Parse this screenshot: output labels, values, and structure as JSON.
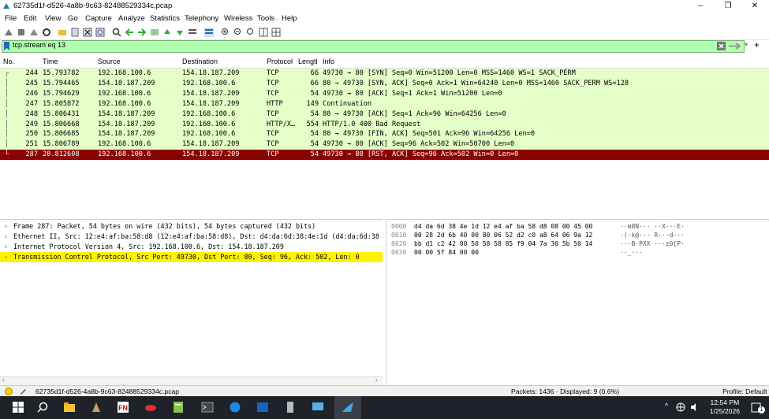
{
  "window": {
    "title": "62735d1f-d526-4a8b-9c63-82488529334c.pcap",
    "minimize": "–",
    "maximize": "❐",
    "close": "✕"
  },
  "menu": [
    "File",
    "Edit",
    "View",
    "Go",
    "Capture",
    "Analyze",
    "Statistics",
    "Telephony",
    "Wireless",
    "Tools",
    "Help"
  ],
  "filter": {
    "value": "tcp.stream eq 13",
    "plus": "+"
  },
  "columns": [
    "No.",
    "Time",
    "Source",
    "Destination",
    "Protocol",
    "Lengtl",
    "Info"
  ],
  "packets": [
    {
      "no": "244",
      "time": "15.793782",
      "src": "192.168.100.6",
      "dst": "154.18.187.209",
      "proto": "TCP",
      "len": "66",
      "info": "49730 → 80 [SYN] Seq=0 Win=51200 Len=0 MSS=1460 WS=1 SACK_PERM"
    },
    {
      "no": "245",
      "time": "15.794465",
      "src": "154.18.187.209",
      "dst": "192.168.100.6",
      "proto": "TCP",
      "len": "66",
      "info": "80 → 49730 [SYN, ACK] Seq=0 Ack=1 Win=64240 Len=0 MSS=1460 SACK_PERM WS=128"
    },
    {
      "no": "246",
      "time": "15.794629",
      "src": "192.168.100.6",
      "dst": "154.18.187.209",
      "proto": "TCP",
      "len": "54",
      "info": "49730 → 80 [ACK] Seq=1 Ack=1 Win=51200 Len=0"
    },
    {
      "no": "247",
      "time": "15.805872",
      "src": "192.168.100.6",
      "dst": "154.18.187.209",
      "proto": "HTTP",
      "len": "149",
      "info": "Continuation"
    },
    {
      "no": "248",
      "time": "15.806431",
      "src": "154.18.187.209",
      "dst": "192.168.100.6",
      "proto": "TCP",
      "len": "54",
      "info": "80 → 49730 [ACK] Seq=1 Ack=96 Win=64256 Len=0"
    },
    {
      "no": "249",
      "time": "15.806668",
      "src": "154.18.187.209",
      "dst": "192.168.100.6",
      "proto": "HTTP/X…",
      "len": "554",
      "info": "HTTP/1.0 400 Bad Request"
    },
    {
      "no": "250",
      "time": "15.806685",
      "src": "154.18.187.209",
      "dst": "192.168.100.6",
      "proto": "TCP",
      "len": "54",
      "info": "80 → 49730 [FIN, ACK] Seq=501 Ack=96 Win=64256 Len=0"
    },
    {
      "no": "251",
      "time": "15.806789",
      "src": "192.168.100.6",
      "dst": "154.18.187.209",
      "proto": "TCP",
      "len": "54",
      "info": "49730 → 80 [ACK] Seq=96 Ack=502 Win=50700 Len=0"
    },
    {
      "no": "287",
      "time": "20.812608",
      "src": "192.168.100.6",
      "dst": "154.18.187.209",
      "proto": "TCP",
      "len": "54",
      "info": "49730 → 80 [RST, ACK] Seq=96 Ack=502 Win=0 Len=0"
    }
  ],
  "details": [
    {
      "text": "Frame 287: Packet, 54 bytes on wire (432 bits), 54 bytes captured (432 bits)"
    },
    {
      "text": "Ethernet II, Src: 12:e4:af:ba:58:d8 (12:e4:af:ba:58:d8), Dst: d4:da:6d:38:4e:1d (d4:da:6d:38"
    },
    {
      "text": "Internet Protocol Version 4, Src: 192.168.100.6, Dst: 154.18.187.209"
    },
    {
      "text": "Transmission Control Protocol, Src Port: 49730, Dst Port: 80, Seq: 96, Ack: 502, Len: 0"
    }
  ],
  "bytes": [
    {
      "off": "0000",
      "hex": "d4 da 6d 38 4e 1d 12 e4  af ba 58 d8 08 00 45 00",
      "ascii": "··m8N··· ··X···E·"
    },
    {
      "off": "0010",
      "hex": "00 28 2d 6b 40 00 80 06  52 d2 c0 a8 64 06 9a 12",
      "ascii": "·(-k@··· R···d···"
    },
    {
      "off": "0020",
      "hex": "bb d1 c2 42 00 50 58 58  85 f9 04 7a 30 5b 50 14",
      "ascii": "···B·PXX ···z0[P·"
    },
    {
      "off": "0030",
      "hex": "00 00 5f 84 00 00",
      "ascii": "··_···"
    }
  ],
  "status": {
    "file": "62735d1f-d526-4a8b-9c63-82488529334c.pcap",
    "packets": "Packets: 1436 · Displayed: 9 (0.6%)",
    "profile": "Profile: Default"
  },
  "taskbar": {
    "time": "12:54 PM",
    "date": "1/25/2026",
    "badge": "1"
  },
  "colors": {
    "tcp_row": "#e7e6ff",
    "green_row": "#e4ffc7",
    "selected_row": "#8b0000",
    "filter_bg": "#afffaf",
    "highlight": "#ffff66"
  }
}
